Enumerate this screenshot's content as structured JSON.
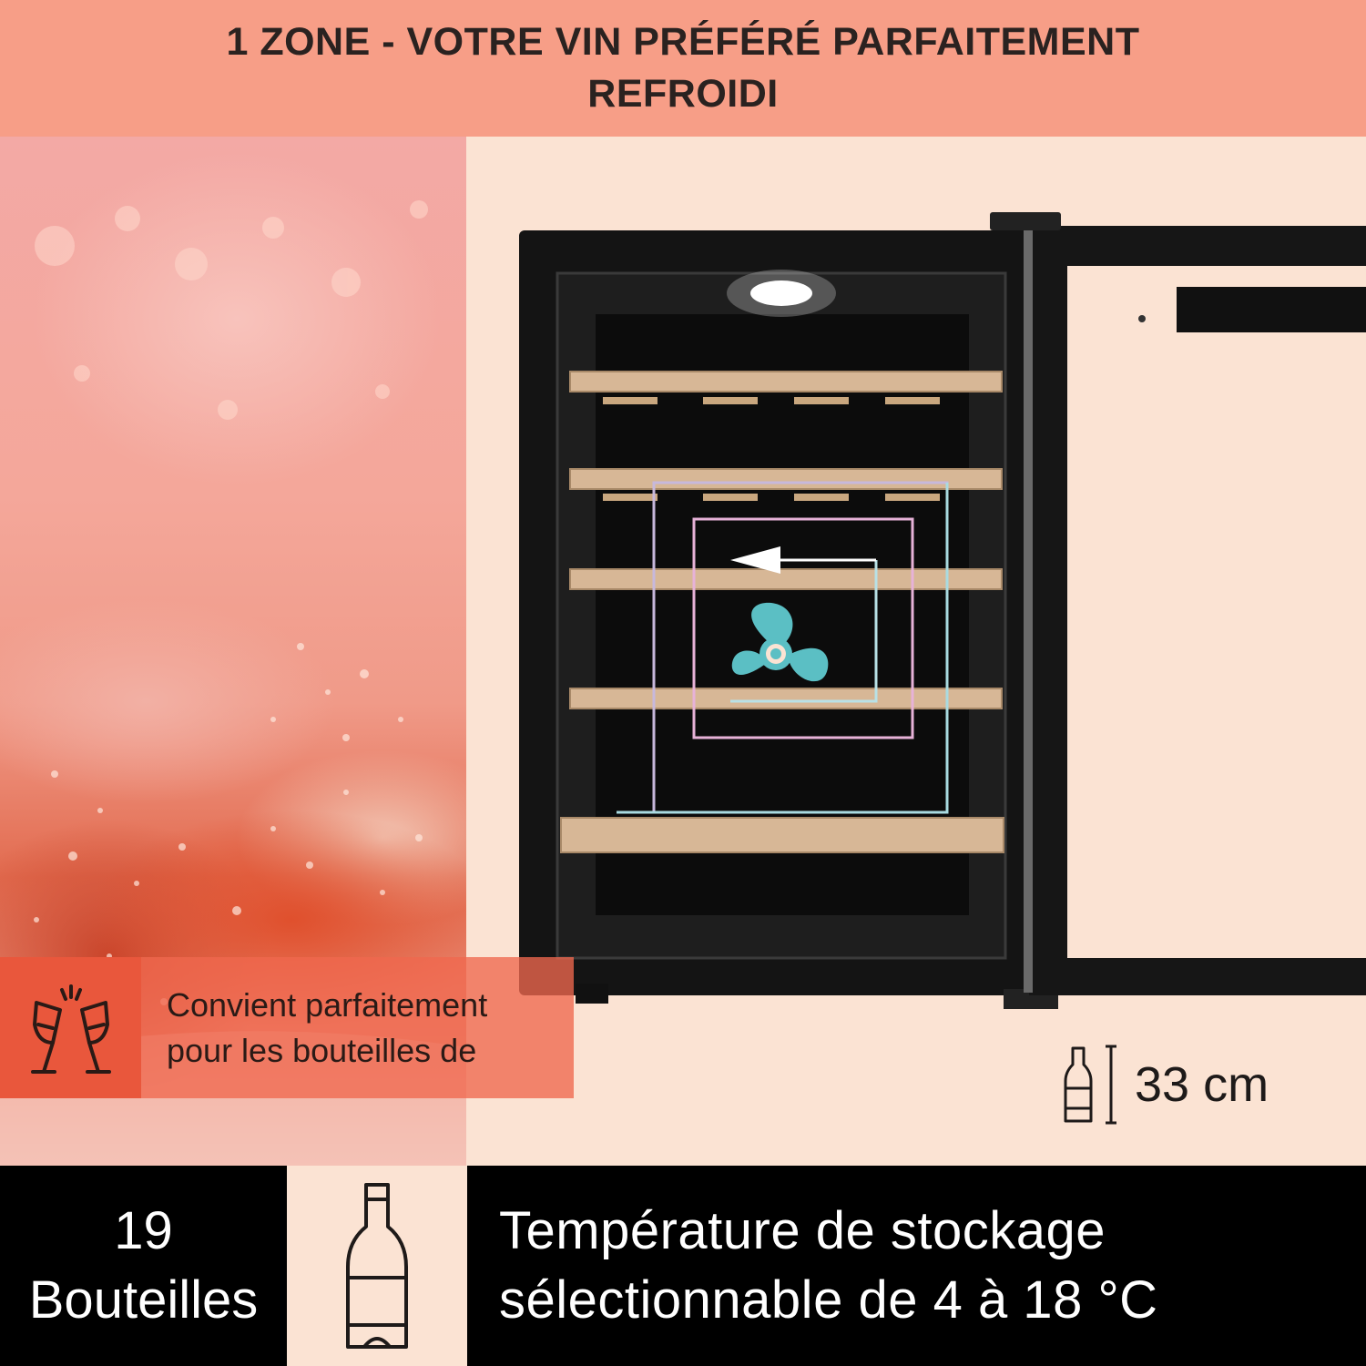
{
  "header": {
    "line1": "1 ZONE - VOTRE VIN PRÉFÉRÉ PARFAITEMENT",
    "line2": "REFROIDI"
  },
  "feature_box": {
    "icon": "toasting-glasses-icon",
    "line1": "Convient parfaitement",
    "line2": "pour les bouteilles de"
  },
  "bottle_size": {
    "icon": "bottle-height-icon",
    "value": "33 cm"
  },
  "footer": {
    "count_line1": "19",
    "count_line2": "Bouteilles",
    "bottle_icon": "wine-bottle-icon",
    "temp_line1": "Température de stockage",
    "temp_line2": "sélectionnable de 4 à 18 °C"
  },
  "colors": {
    "header_bg": "#f79e87",
    "panel_bg": "#fbe3d3",
    "accent": "#e9573c",
    "footer_bg": "#000000",
    "fan": "#5bbfc4"
  }
}
